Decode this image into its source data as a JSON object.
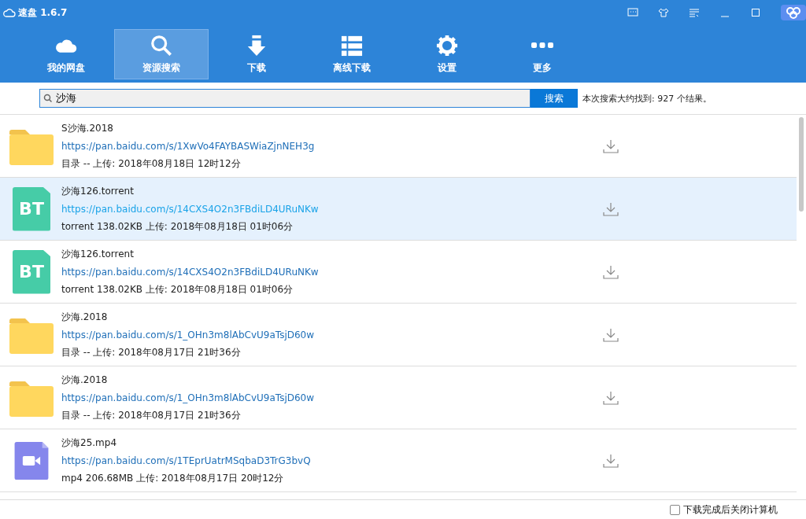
{
  "window": {
    "title": "速盘 1.6.7"
  },
  "nav": [
    {
      "label": "我的网盘",
      "kind": "cloud",
      "selected": false
    },
    {
      "label": "资源搜索",
      "kind": "search",
      "selected": true
    },
    {
      "label": "下载",
      "kind": "download",
      "selected": false
    },
    {
      "label": "离线下载",
      "kind": "list",
      "selected": false
    },
    {
      "label": "设置",
      "kind": "gear",
      "selected": false
    },
    {
      "label": "更多",
      "kind": "more",
      "selected": false
    }
  ],
  "search": {
    "value": "沙海",
    "button": "搜索",
    "result": "本次搜索大约找到: 927 个结果。"
  },
  "results": [
    {
      "kind": "folder",
      "selected": false,
      "name": "S沙海.2018",
      "link": "https://pan.baidu.com/s/1XwVo4FAYBASWiaZjnNEH3g",
      "meta": "目录 -- 上传: 2018年08月18日 12时12分"
    },
    {
      "kind": "bt",
      "badge": "BT",
      "selected": true,
      "name": "沙海126.torrent",
      "link": "https://pan.baidu.com/s/14CXS4O2n3FBdiLD4URuNKw",
      "meta": "torrent 138.02KB 上传: 2018年08月18日 01时06分"
    },
    {
      "kind": "bt",
      "badge": "BT",
      "selected": false,
      "name": "沙海126.torrent",
      "link": "https://pan.baidu.com/s/14CXS4O2n3FBdiLD4URuNKw",
      "meta": "torrent 138.02KB 上传: 2018年08月18日 01时06分"
    },
    {
      "kind": "folder",
      "selected": false,
      "name": "沙海.2018",
      "link": "https://pan.baidu.com/s/1_OHn3m8lAbCvU9aTsjD60w",
      "meta": "目录 -- 上传: 2018年08月17日 21时36分"
    },
    {
      "kind": "folder",
      "selected": false,
      "name": "沙海.2018",
      "link": "https://pan.baidu.com/s/1_OHn3m8lAbCvU9aTsjD60w",
      "meta": "目录 -- 上传: 2018年08月17日 21时36分"
    },
    {
      "kind": "video",
      "selected": false,
      "name": "沙海25.mp4",
      "link": "https://pan.baidu.com/s/1TEprUatrMSqbaD3TrG3bvQ",
      "meta": "mp4 206.68MB 上传: 2018年08月17日 20时12分"
    }
  ],
  "footer": {
    "label": "下载完成后关闭计算机",
    "checked": false
  }
}
